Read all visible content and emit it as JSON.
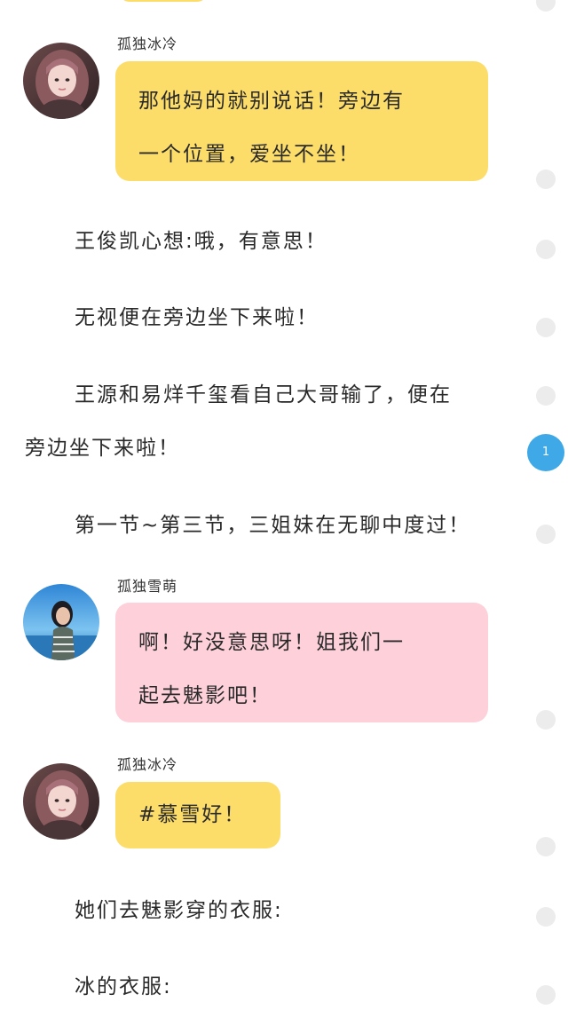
{
  "messages": [
    {
      "sender": "孤独冰冷",
      "color": "#fddd6a",
      "lines": [
        "那他妈的就别说话！旁边有",
        "一个位置，爱坐不坐！"
      ]
    },
    {
      "sender": "孤独雪萌",
      "color": "#fdd0da",
      "lines": [
        "啊！好没意思呀！姐我们一",
        "起去魅影吧！"
      ]
    },
    {
      "sender": "孤独冰冷",
      "color": "#fddd6a",
      "lines": [
        "#慕雪好！"
      ]
    }
  ],
  "narration": [
    "王俊凯心想:哦，有意思！",
    "无视便在旁边坐下来啦！",
    "王源和易烊千玺看自己大哥输了，便在",
    "旁边坐下来啦！",
    "第一节~第三节，三姐妹在无聊中度过！",
    "她们去魅影穿的衣服:",
    "冰的衣服:"
  ],
  "badge": {
    "count": "1",
    "color": "#3ea9e6"
  },
  "avatars": [
    {
      "icon": "girl-portrait-pink-hair"
    },
    {
      "icon": "girl-portrait-seaside"
    },
    {
      "icon": "girl-portrait-pink-hair"
    }
  ]
}
